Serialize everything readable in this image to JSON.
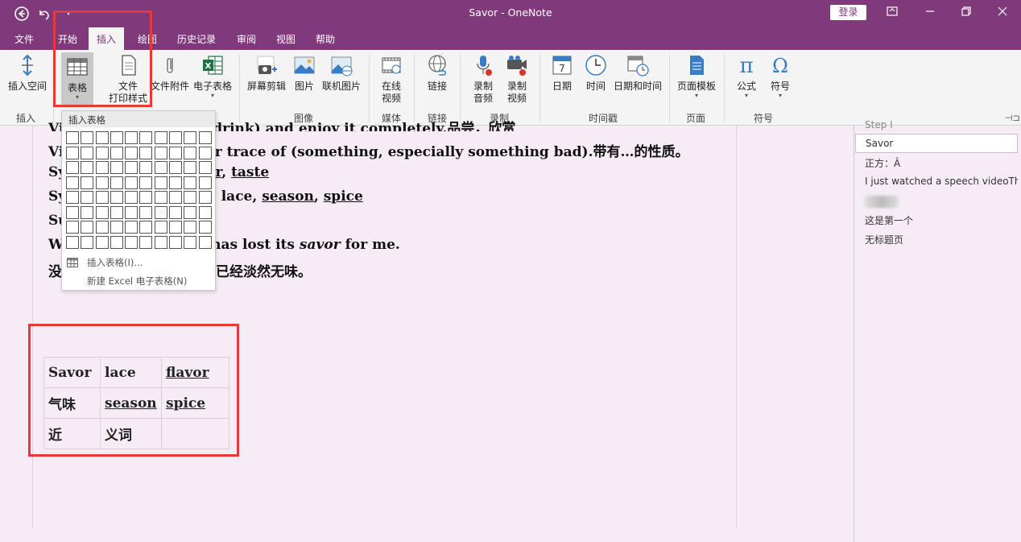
{
  "window": {
    "title": "Savor  -  OneNote",
    "login_label": "登录"
  },
  "tabs": [
    {
      "label": "文件"
    },
    {
      "label": "开始"
    },
    {
      "label": "插入"
    },
    {
      "label": "绘图"
    },
    {
      "label": "历史记录"
    },
    {
      "label": "审阅"
    },
    {
      "label": "视图"
    },
    {
      "label": "帮助"
    }
  ],
  "ribbon": {
    "insert_space": "插入空间",
    "table": "表格",
    "file_printout_1": "文件",
    "file_printout_2": "打印样式",
    "file_attachment": "文件附件",
    "spreadsheet": "电子表格",
    "screen_clip": "屏幕剪辑",
    "picture": "图片",
    "online_picture": "联机图片",
    "online_video_1": "在线",
    "online_video_2": "视频",
    "link": "链接",
    "record_audio_1": "录制",
    "record_audio_2": "音频",
    "record_video_1": "录制",
    "record_video_2": "视频",
    "date": "日期",
    "time": "时间",
    "datetime": "日期和时间",
    "page_template": "页面模板",
    "equation": "公式",
    "symbol": "符号",
    "date_icon_number": "7",
    "groups": {
      "insert": "插入",
      "images": "图像",
      "media": "媒体",
      "links": "链接",
      "recording": "录制",
      "timestamp": "时间戳",
      "pages": "页面",
      "symbols": "符号"
    }
  },
  "dropdown": {
    "header": "插入表格",
    "insert_table": "插入表格(I)...",
    "new_excel": "新建 Excel 电子表格(N)",
    "grid_rows": 8,
    "grid_cols": 10
  },
  "note": {
    "line1_a": "Vi",
    "line1_b": "r drink) and enjoy it completely.品尝，欣赏",
    "line2_a": "Vi",
    "line2_b": "or trace of (something, especially something bad).带有…的性质。",
    "line3_a": "Sy",
    "line3_b": "or",
    "line3_c": ", ",
    "line3_d": "taste",
    "line4_a": "Sy",
    "line4_b": "r",
    "line4_c": ", lace, ",
    "line4_d": "season",
    "line4_e": ", ",
    "line4_f": "spice",
    "line5_a": "Su",
    "line6_a": " W",
    "line6_b": "has lost its ",
    "line6_c": "savor",
    "line6_d": " for me.",
    "line7_a": "没",
    "line7_b": "说已经淡然无味。",
    "table": [
      [
        "Savor",
        "lace",
        "flavor"
      ],
      [
        "气味",
        "season",
        "spice"
      ],
      [
        "近",
        "义词",
        ""
      ]
    ]
  },
  "sidebar": {
    "items": [
      "Step I",
      "Savor",
      "正方：Â",
      "I just watched a speech videoTh",
      "这是第一个",
      "无标题页"
    ]
  },
  "colors": {
    "accent": "#80397b",
    "highlight_box": "#e8393a"
  }
}
